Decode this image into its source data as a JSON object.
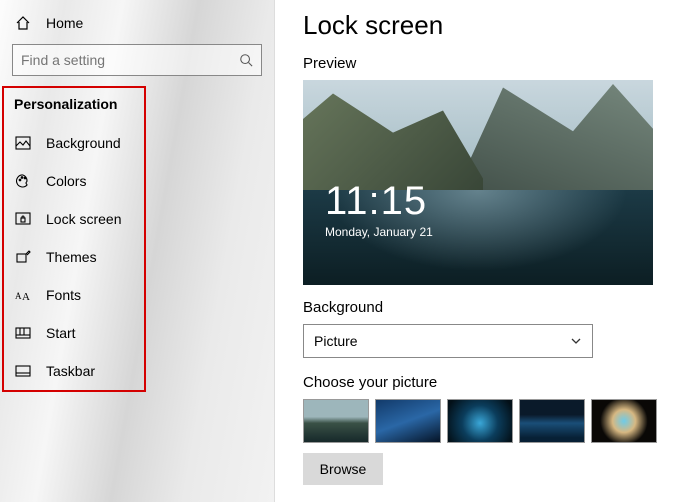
{
  "sidebar": {
    "home_label": "Home",
    "search_placeholder": "Find a setting",
    "section_header": "Personalization",
    "items": [
      {
        "label": "Background"
      },
      {
        "label": "Colors"
      },
      {
        "label": "Lock screen"
      },
      {
        "label": "Themes"
      },
      {
        "label": "Fonts"
      },
      {
        "label": "Start"
      },
      {
        "label": "Taskbar"
      }
    ]
  },
  "main": {
    "title": "Lock screen",
    "preview_label": "Preview",
    "clock": {
      "time": "11:15",
      "date": "Monday, January 21"
    },
    "background_label": "Background",
    "background_value": "Picture",
    "choose_label": "Choose your picture",
    "browse_label": "Browse"
  }
}
